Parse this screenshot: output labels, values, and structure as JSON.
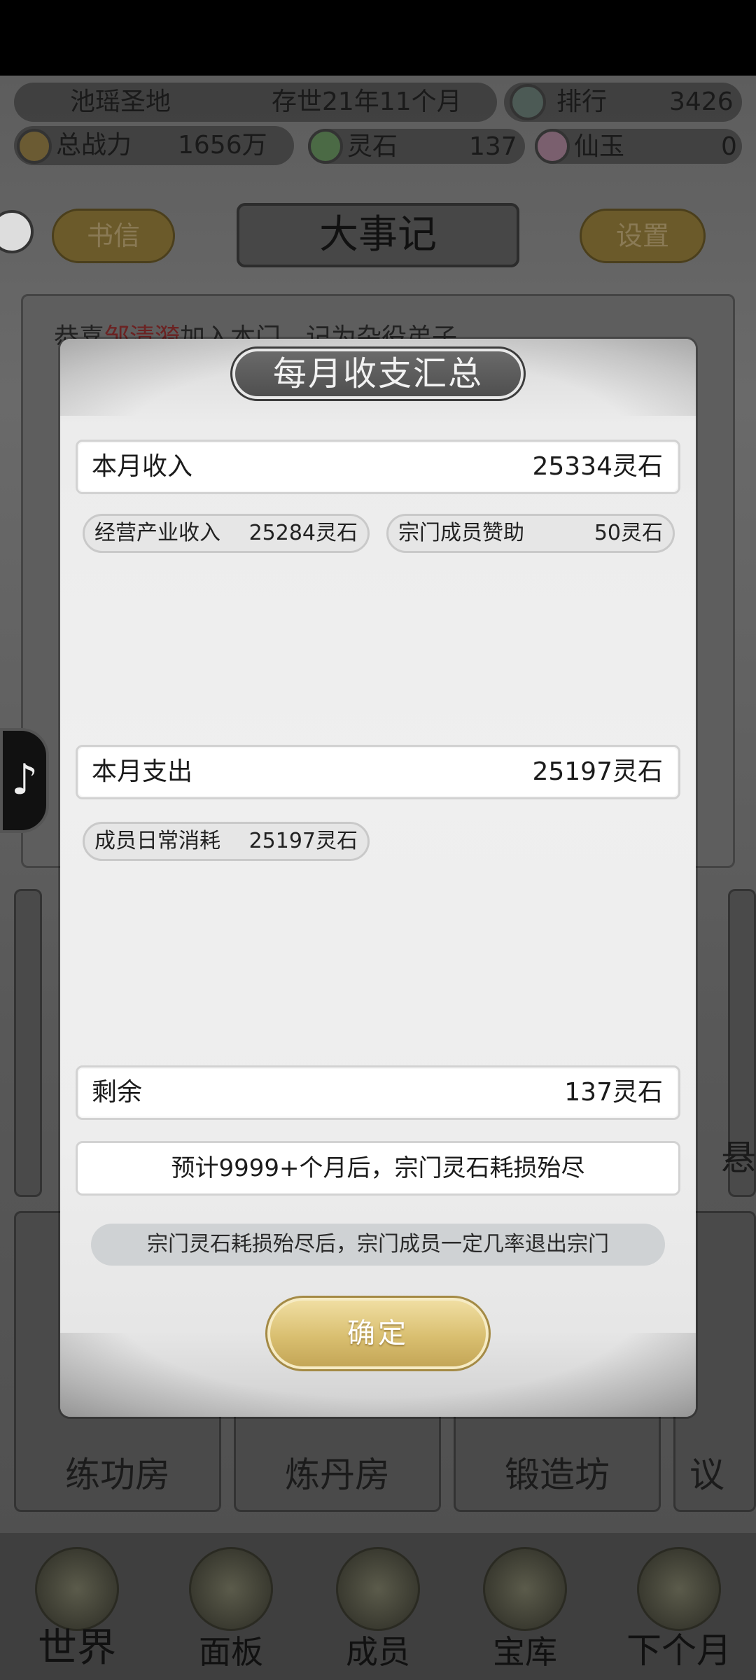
{
  "hud": {
    "sect_name": "池瑶圣地",
    "age": "存世21年11个月",
    "rank_label": "排行",
    "rank_value": "3426",
    "power_label": "总战力",
    "power_value": "1656万",
    "spirit_stone_label": "灵石",
    "spirit_stone_value": "137",
    "jade_label": "仙玉",
    "jade_value": "0"
  },
  "top_buttons": {
    "letters": "书信",
    "chronicle": "大事记",
    "settings": "设置"
  },
  "log": {
    "line1_prefix": "恭喜",
    "line1_name": "邹清漪",
    "line1_suffix": "加入本门，记为杂役弟子"
  },
  "rooms": [
    {
      "label": "练功房"
    },
    {
      "label": "炼丹房"
    },
    {
      "label": "锻造坊"
    },
    {
      "label": "议"
    }
  ],
  "side_room_partial": "悬",
  "nav": [
    {
      "label": "世界"
    },
    {
      "label": "面板"
    },
    {
      "label": "成员"
    },
    {
      "label": "宝库"
    },
    {
      "label": "下个月"
    }
  ],
  "dialog": {
    "title": "每月收支汇总",
    "income": {
      "label": "本月收入",
      "value": "25334灵石"
    },
    "income_items": [
      {
        "label": "经营产业收入",
        "value": "25284灵石"
      },
      {
        "label": "宗门成员赞助",
        "value": "50灵石"
      }
    ],
    "expense": {
      "label": "本月支出",
      "value": "25197灵石"
    },
    "expense_items": [
      {
        "label": "成员日常消耗",
        "value": "25197灵石"
      }
    ],
    "remaining": {
      "label": "剩余",
      "value": "137灵石"
    },
    "forecast": "预计9999+个月后，宗门灵石耗损殆尽",
    "warning": "宗门灵石耗损殆尽后，宗门成员一定几率退出宗门",
    "confirm": "确定"
  }
}
